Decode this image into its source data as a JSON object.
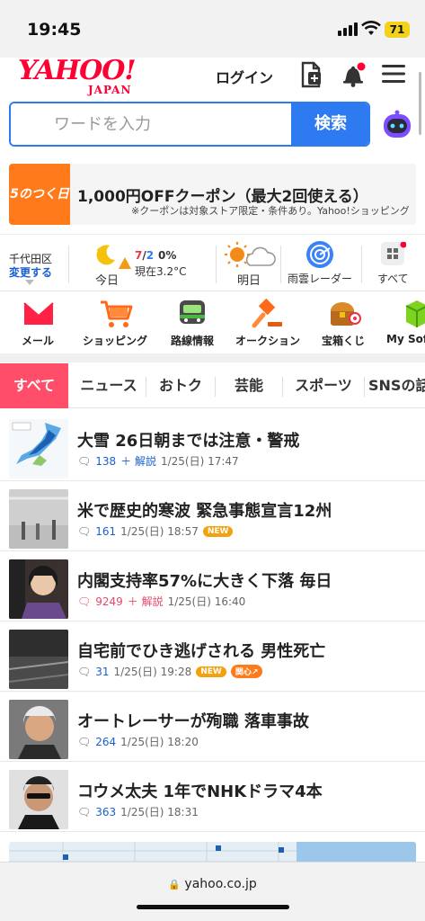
{
  "status_bar": {
    "time": "19:45",
    "battery": "71"
  },
  "header": {
    "logo_main": "YAHOO!",
    "logo_sub": "JAPAN",
    "login": "ログイン",
    "icons": [
      "card-add-icon",
      "bell-icon",
      "menu-icon"
    ]
  },
  "search": {
    "placeholder": "ワードを入力",
    "button": "検索"
  },
  "coupon": {
    "badge": "5のつく日",
    "title": "1,000円OFFクーポン（最大2回使える）",
    "note": "※クーポンは対象ストア限定・条件あり。Yahoo!ショッピング"
  },
  "weather": {
    "location": "千代田区",
    "change": "変更する",
    "today_label": "今日",
    "temps": "7/2",
    "temp_high": "7",
    "temp_low": "2",
    "precip": "0%",
    "current": "現在3.2°C",
    "tomorrow_label": "明日",
    "radar_label": "雨雲レーダー",
    "all_label": "すべて"
  },
  "services": [
    {
      "label": "メール",
      "icon": "mail-icon"
    },
    {
      "label": "ショッピング",
      "icon": "cart-icon"
    },
    {
      "label": "路線情報",
      "icon": "train-icon"
    },
    {
      "label": "オークション",
      "icon": "gavel-icon"
    },
    {
      "label": "宝箱くじ",
      "icon": "treasure-icon"
    },
    {
      "label": "My Soft",
      "icon": "box-icon"
    }
  ],
  "tabs": [
    "すべて",
    "ニュース",
    "おトク",
    "芸能",
    "スポーツ",
    "SNSの話"
  ],
  "news": [
    {
      "title": "大雪 26日朝までは注意・警戒",
      "count": "138",
      "extra": "＋ 解説",
      "date": "1/25(日) 17:47",
      "tag": ""
    },
    {
      "title": "米で歴史的寒波 緊急事態宣言12州",
      "count": "161",
      "extra": "",
      "date": "1/25(日) 18:57",
      "tag": "NEW"
    },
    {
      "title": "内閣支持率57%に大きく下落 毎日",
      "count": "9249",
      "extra": "＋ 解説",
      "date": "1/25(日) 16:40",
      "tag": ""
    },
    {
      "title": "自宅前でひき逃げされる 男性死亡",
      "count": "31",
      "extra": "",
      "date": "1/25(日) 19:28",
      "tag": "NEW",
      "tag2": "関心↗"
    },
    {
      "title": "オートレーサーが殉職 落車事故",
      "count": "264",
      "extra": "",
      "date": "1/25(日) 18:20",
      "tag": ""
    },
    {
      "title": "コウメ太夫 1年でNHKドラマ4本",
      "count": "363",
      "extra": "",
      "date": "1/25(日) 18:31",
      "tag": ""
    }
  ],
  "address_bar": {
    "url": "yahoo.co.jp"
  }
}
